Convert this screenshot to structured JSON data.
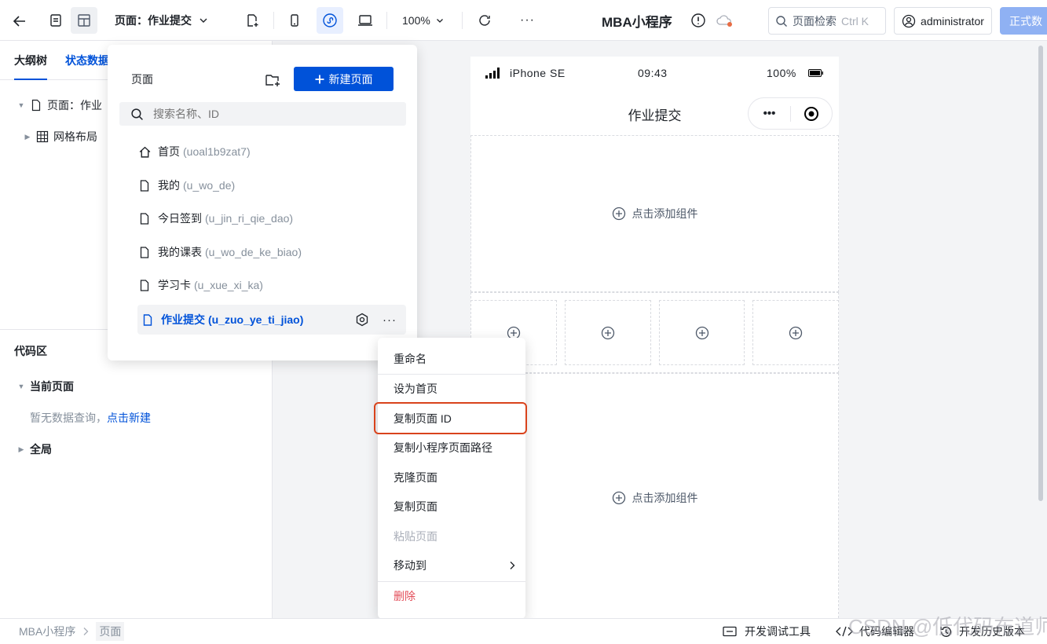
{
  "topbar": {
    "page_selector": "页面：作业提交",
    "zoom": "100%",
    "more": "···",
    "app_title": "MBA小程序",
    "search_label": "页面检索",
    "search_shortcut": "Ctrl K",
    "user": "administrator",
    "publish": "正式数"
  },
  "sidebar": {
    "tabs": [
      "大纲树",
      "状态数据"
    ],
    "tree": {
      "page": "页面：作业",
      "grid": "网格布局"
    },
    "code": {
      "title": "代码区",
      "current_page": "当前页面",
      "empty_text": "暂无数据查询，",
      "create_link": "点击新建",
      "global": "全局"
    }
  },
  "popover": {
    "title": "页面",
    "new_page": "新建页面",
    "search_placeholder": "搜索名称、ID",
    "pages": [
      {
        "name": "首页",
        "id": "(uoal1b9zat7)",
        "icon": "home-icon"
      },
      {
        "name": "我的",
        "id": "(u_wo_de)",
        "icon": "file-icon"
      },
      {
        "name": "今日签到",
        "id": "(u_jin_ri_qie_dao)",
        "icon": "file-icon"
      },
      {
        "name": "我的课表",
        "id": "(u_wo_de_ke_biao)",
        "icon": "file-icon"
      },
      {
        "name": "学习卡",
        "id": "(u_xue_xi_ka)",
        "icon": "file-icon"
      },
      {
        "name": "作业提交",
        "id": "(u_zuo_ye_ti_jiao)",
        "icon": "file-icon"
      }
    ]
  },
  "phone": {
    "carrier": "iPhone SE",
    "time": "09:43",
    "battery": "100%",
    "nav_title": "作业提交",
    "capsule_more": "•••",
    "add_component": "点击添加组件"
  },
  "context_menu": {
    "items": [
      "重命名",
      "设为首页",
      "复制页面 ID",
      "复制小程序页面路径",
      "克隆页面",
      "复制页面",
      "粘贴页面",
      "移动到",
      "删除"
    ]
  },
  "statusbar": {
    "breadcrumb_app": "MBA小程序",
    "breadcrumb_page": "页面",
    "debug_tool": "开发调试工具",
    "code_editor": "代码编辑器",
    "history": "开发历史版本"
  },
  "watermark": "CSDN @低代码布道师",
  "colors": {
    "primary": "#0052d9",
    "highlight_border": "#d9431c",
    "danger": "#e34d59",
    "publish_bg": "#8fb1f3"
  }
}
